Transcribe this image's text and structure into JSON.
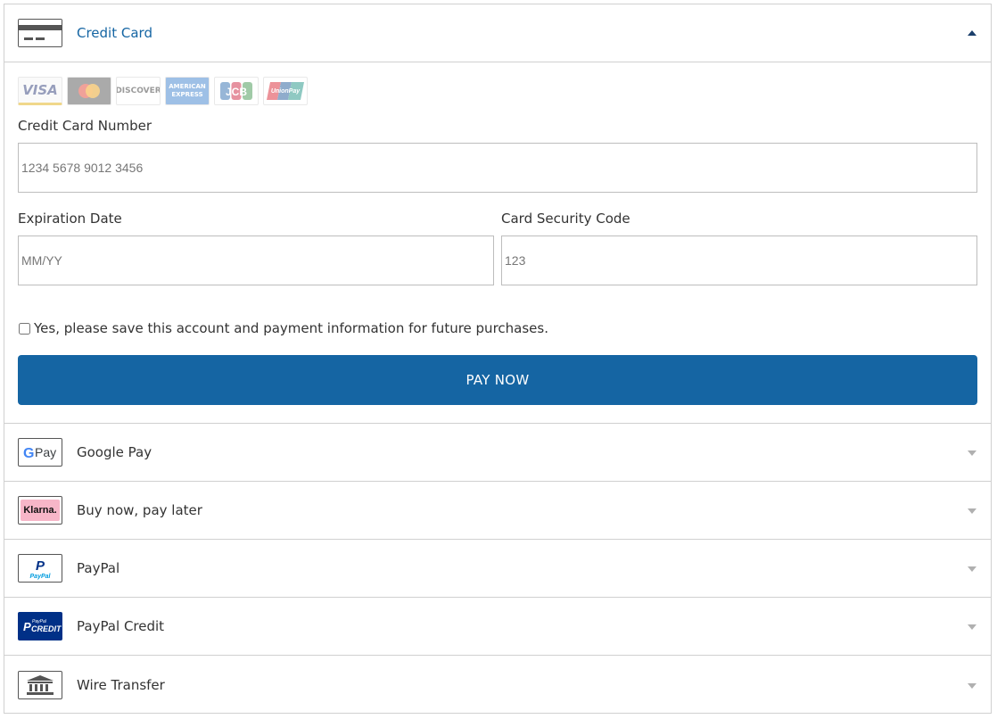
{
  "credit_card": {
    "label": "Credit Card",
    "card_brands": [
      "VISA",
      "Mastercard",
      "DISCOVER",
      "AMERICAN EXPRESS",
      "JCB",
      "UnionPay"
    ],
    "number_label": "Credit Card Number",
    "number_placeholder": "1234 5678 9012 3456",
    "expiration_label": "Expiration Date",
    "expiration_placeholder": "MM/YY",
    "security_label": "Card Security Code",
    "security_placeholder": "123",
    "save_text": "Yes, please save this account and payment information for future purchases.",
    "pay_button": "PAY NOW"
  },
  "methods": [
    {
      "label": "Google Pay",
      "icon": "google-pay-icon"
    },
    {
      "label": "Buy now, pay later",
      "icon": "klarna-icon"
    },
    {
      "label": "PayPal",
      "icon": "paypal-icon"
    },
    {
      "label": "PayPal Credit",
      "icon": "paypal-credit-icon"
    },
    {
      "label": "Wire Transfer",
      "icon": "bank-icon"
    }
  ],
  "icon_text": {
    "gpay": "Pay",
    "klarna": "Klarna.",
    "paypal": "PayPal",
    "paypal_credit_small": "PayPal",
    "paypal_credit": "CREDIT"
  },
  "colors": {
    "accent": "#1565a3",
    "border": "#d0d0d0"
  }
}
